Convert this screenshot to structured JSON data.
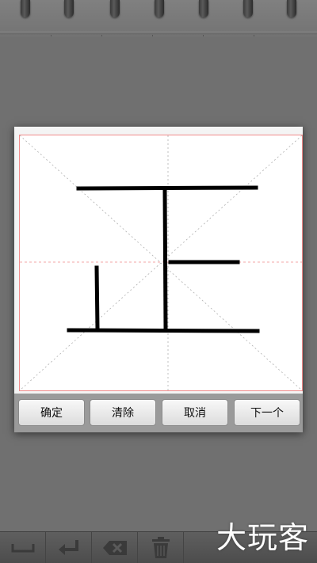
{
  "dialog": {
    "buttons": {
      "confirm": "确定",
      "clear": "清除",
      "cancel": "取消",
      "next": "下一个"
    }
  },
  "canvas": {
    "guide_color": "#f08a8a",
    "stroke_color": "#000000"
  },
  "toolbar": {
    "items": [
      "space-icon",
      "enter-icon",
      "backspace-icon",
      "trash-icon"
    ]
  },
  "watermark": "大玩客"
}
